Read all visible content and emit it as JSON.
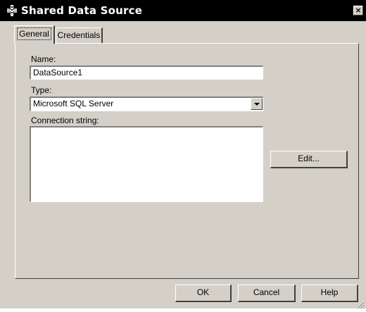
{
  "window": {
    "title": "Shared Data Source",
    "close_label": "×"
  },
  "tabs": [
    {
      "label": "General",
      "selected": true
    },
    {
      "label": "Credentials",
      "selected": false
    }
  ],
  "form": {
    "name_label": "Name:",
    "name_value": "DataSource1",
    "type_label": "Type:",
    "type_value": "Microsoft SQL Server",
    "connection_label": "Connection string:",
    "connection_value": "",
    "edit_label": "Edit..."
  },
  "footer": {
    "ok_label": "OK",
    "cancel_label": "Cancel",
    "help_label": "Help"
  },
  "colors": {
    "titlebar": "#000000",
    "dialog_face": "#d4d0c8",
    "field_background": "#ffffff"
  },
  "icons": {
    "title_icon": "data-source-icon",
    "dropdown": "chevron-down-icon",
    "resize": "resize-grip-icon"
  }
}
